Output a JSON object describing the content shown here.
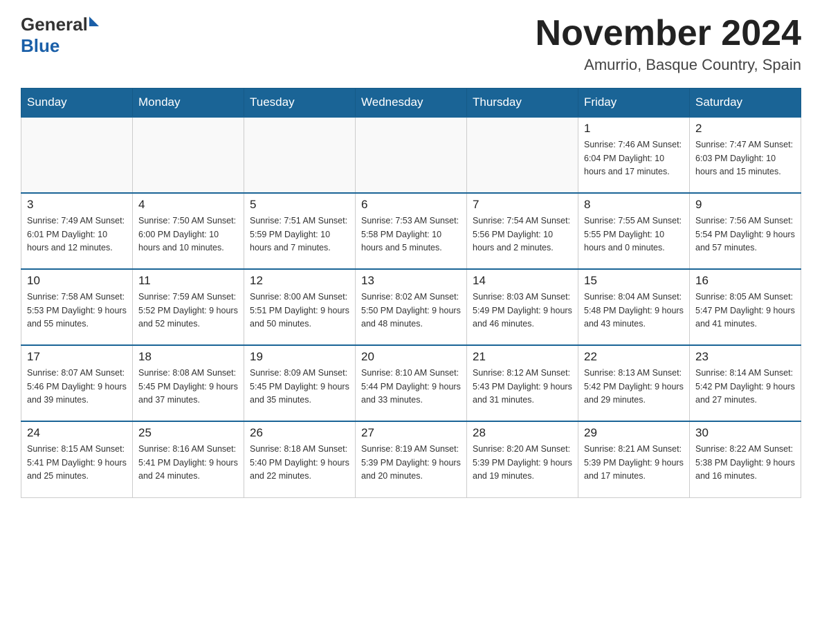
{
  "header": {
    "title": "November 2024",
    "subtitle": "Amurrio, Basque Country, Spain",
    "logo_general": "General",
    "logo_blue": "Blue"
  },
  "days_of_week": [
    "Sunday",
    "Monday",
    "Tuesday",
    "Wednesday",
    "Thursday",
    "Friday",
    "Saturday"
  ],
  "weeks": [
    {
      "days": [
        {
          "date": "",
          "info": ""
        },
        {
          "date": "",
          "info": ""
        },
        {
          "date": "",
          "info": ""
        },
        {
          "date": "",
          "info": ""
        },
        {
          "date": "",
          "info": ""
        },
        {
          "date": "1",
          "info": "Sunrise: 7:46 AM\nSunset: 6:04 PM\nDaylight: 10 hours\nand 17 minutes."
        },
        {
          "date": "2",
          "info": "Sunrise: 7:47 AM\nSunset: 6:03 PM\nDaylight: 10 hours\nand 15 minutes."
        }
      ]
    },
    {
      "days": [
        {
          "date": "3",
          "info": "Sunrise: 7:49 AM\nSunset: 6:01 PM\nDaylight: 10 hours\nand 12 minutes."
        },
        {
          "date": "4",
          "info": "Sunrise: 7:50 AM\nSunset: 6:00 PM\nDaylight: 10 hours\nand 10 minutes."
        },
        {
          "date": "5",
          "info": "Sunrise: 7:51 AM\nSunset: 5:59 PM\nDaylight: 10 hours\nand 7 minutes."
        },
        {
          "date": "6",
          "info": "Sunrise: 7:53 AM\nSunset: 5:58 PM\nDaylight: 10 hours\nand 5 minutes."
        },
        {
          "date": "7",
          "info": "Sunrise: 7:54 AM\nSunset: 5:56 PM\nDaylight: 10 hours\nand 2 minutes."
        },
        {
          "date": "8",
          "info": "Sunrise: 7:55 AM\nSunset: 5:55 PM\nDaylight: 10 hours\nand 0 minutes."
        },
        {
          "date": "9",
          "info": "Sunrise: 7:56 AM\nSunset: 5:54 PM\nDaylight: 9 hours\nand 57 minutes."
        }
      ]
    },
    {
      "days": [
        {
          "date": "10",
          "info": "Sunrise: 7:58 AM\nSunset: 5:53 PM\nDaylight: 9 hours\nand 55 minutes."
        },
        {
          "date": "11",
          "info": "Sunrise: 7:59 AM\nSunset: 5:52 PM\nDaylight: 9 hours\nand 52 minutes."
        },
        {
          "date": "12",
          "info": "Sunrise: 8:00 AM\nSunset: 5:51 PM\nDaylight: 9 hours\nand 50 minutes."
        },
        {
          "date": "13",
          "info": "Sunrise: 8:02 AM\nSunset: 5:50 PM\nDaylight: 9 hours\nand 48 minutes."
        },
        {
          "date": "14",
          "info": "Sunrise: 8:03 AM\nSunset: 5:49 PM\nDaylight: 9 hours\nand 46 minutes."
        },
        {
          "date": "15",
          "info": "Sunrise: 8:04 AM\nSunset: 5:48 PM\nDaylight: 9 hours\nand 43 minutes."
        },
        {
          "date": "16",
          "info": "Sunrise: 8:05 AM\nSunset: 5:47 PM\nDaylight: 9 hours\nand 41 minutes."
        }
      ]
    },
    {
      "days": [
        {
          "date": "17",
          "info": "Sunrise: 8:07 AM\nSunset: 5:46 PM\nDaylight: 9 hours\nand 39 minutes."
        },
        {
          "date": "18",
          "info": "Sunrise: 8:08 AM\nSunset: 5:45 PM\nDaylight: 9 hours\nand 37 minutes."
        },
        {
          "date": "19",
          "info": "Sunrise: 8:09 AM\nSunset: 5:45 PM\nDaylight: 9 hours\nand 35 minutes."
        },
        {
          "date": "20",
          "info": "Sunrise: 8:10 AM\nSunset: 5:44 PM\nDaylight: 9 hours\nand 33 minutes."
        },
        {
          "date": "21",
          "info": "Sunrise: 8:12 AM\nSunset: 5:43 PM\nDaylight: 9 hours\nand 31 minutes."
        },
        {
          "date": "22",
          "info": "Sunrise: 8:13 AM\nSunset: 5:42 PM\nDaylight: 9 hours\nand 29 minutes."
        },
        {
          "date": "23",
          "info": "Sunrise: 8:14 AM\nSunset: 5:42 PM\nDaylight: 9 hours\nand 27 minutes."
        }
      ]
    },
    {
      "days": [
        {
          "date": "24",
          "info": "Sunrise: 8:15 AM\nSunset: 5:41 PM\nDaylight: 9 hours\nand 25 minutes."
        },
        {
          "date": "25",
          "info": "Sunrise: 8:16 AM\nSunset: 5:41 PM\nDaylight: 9 hours\nand 24 minutes."
        },
        {
          "date": "26",
          "info": "Sunrise: 8:18 AM\nSunset: 5:40 PM\nDaylight: 9 hours\nand 22 minutes."
        },
        {
          "date": "27",
          "info": "Sunrise: 8:19 AM\nSunset: 5:39 PM\nDaylight: 9 hours\nand 20 minutes."
        },
        {
          "date": "28",
          "info": "Sunrise: 8:20 AM\nSunset: 5:39 PM\nDaylight: 9 hours\nand 19 minutes."
        },
        {
          "date": "29",
          "info": "Sunrise: 8:21 AM\nSunset: 5:39 PM\nDaylight: 9 hours\nand 17 minutes."
        },
        {
          "date": "30",
          "info": "Sunrise: 8:22 AM\nSunset: 5:38 PM\nDaylight: 9 hours\nand 16 minutes."
        }
      ]
    }
  ]
}
